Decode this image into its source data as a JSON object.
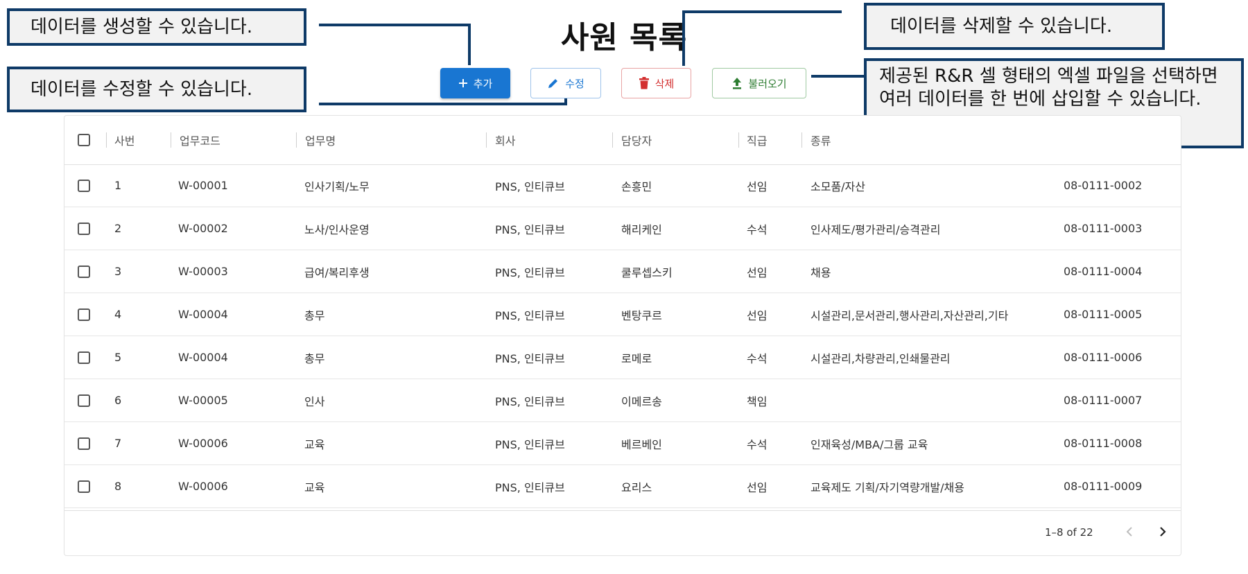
{
  "title": "사원 목록",
  "toolbar": {
    "add_label": "추가",
    "edit_label": "수정",
    "delete_label": "삭제",
    "load_label": "불러오기"
  },
  "callouts": {
    "create": "데이터를 생성할 수 있습니다.",
    "edit": "데이터를 수정할 수 있습니다.",
    "delete": "데이터를 삭제할 수 있습니다.",
    "load": "제공된 R&R 셀 형태의 엑셀 파일을 선택하면 여러 데이터를 한 번에 삽입할 수 있습니다."
  },
  "columns": [
    "사번",
    "업무코드",
    "업무명",
    "회사",
    "담당자",
    "직급",
    "종류"
  ],
  "rows": [
    {
      "no": "1",
      "code": "W-00001",
      "task": "인사기획/노무",
      "company": "PNS, 인티큐브",
      "manager": "손흥민",
      "rank": "선임",
      "kind": "소모품/자산",
      "id": "08-0111-0002"
    },
    {
      "no": "2",
      "code": "W-00002",
      "task": "노사/인사운영",
      "company": "PNS, 인티큐브",
      "manager": "해리케인",
      "rank": "수석",
      "kind": "인사제도/평가관리/승격관리",
      "id": "08-0111-0003"
    },
    {
      "no": "3",
      "code": "W-00003",
      "task": "급여/복리후생",
      "company": "PNS, 인티큐브",
      "manager": "쿨루셉스키",
      "rank": "선임",
      "kind": "채용",
      "id": "08-0111-0004"
    },
    {
      "no": "4",
      "code": "W-00004",
      "task": "총무",
      "company": "PNS, 인티큐브",
      "manager": "벤탕쿠르",
      "rank": "선임",
      "kind": "시설관리,문서관리,행사관리,자산관리,기타",
      "id": "08-0111-0005"
    },
    {
      "no": "5",
      "code": "W-00004",
      "task": "총무",
      "company": "PNS, 인티큐브",
      "manager": "로메로",
      "rank": "수석",
      "kind": "시설관리,차량관리,인쇄물관리",
      "id": "08-0111-0006"
    },
    {
      "no": "6",
      "code": "W-00005",
      "task": "인사",
      "company": "PNS, 인티큐브",
      "manager": "이메르송",
      "rank": "책임",
      "kind": "",
      "id": "08-0111-0007"
    },
    {
      "no": "7",
      "code": "W-00006",
      "task": "교육",
      "company": "PNS, 인티큐브",
      "manager": "베르베인",
      "rank": "수석",
      "kind": "인재육성/MBA/그룹 교육",
      "id": "08-0111-0008"
    },
    {
      "no": "8",
      "code": "W-00006",
      "task": "교육",
      "company": "PNS, 인티큐브",
      "manager": "요리스",
      "rank": "선임",
      "kind": "교육제도 기획/자기역량개발/채용",
      "id": "08-0111-0009"
    }
  ],
  "pagination": {
    "range": "1–8 of 22"
  },
  "icons": {
    "add": "plus-icon",
    "edit": "pencil-icon",
    "delete": "trash-icon",
    "load": "upload-icon",
    "prev": "chevron-left-icon",
    "next": "chevron-right-icon"
  },
  "colors": {
    "primary": "#1976d2",
    "danger": "#d32f2f",
    "success": "#2e7d32",
    "callout_border": "#0e3a67"
  }
}
